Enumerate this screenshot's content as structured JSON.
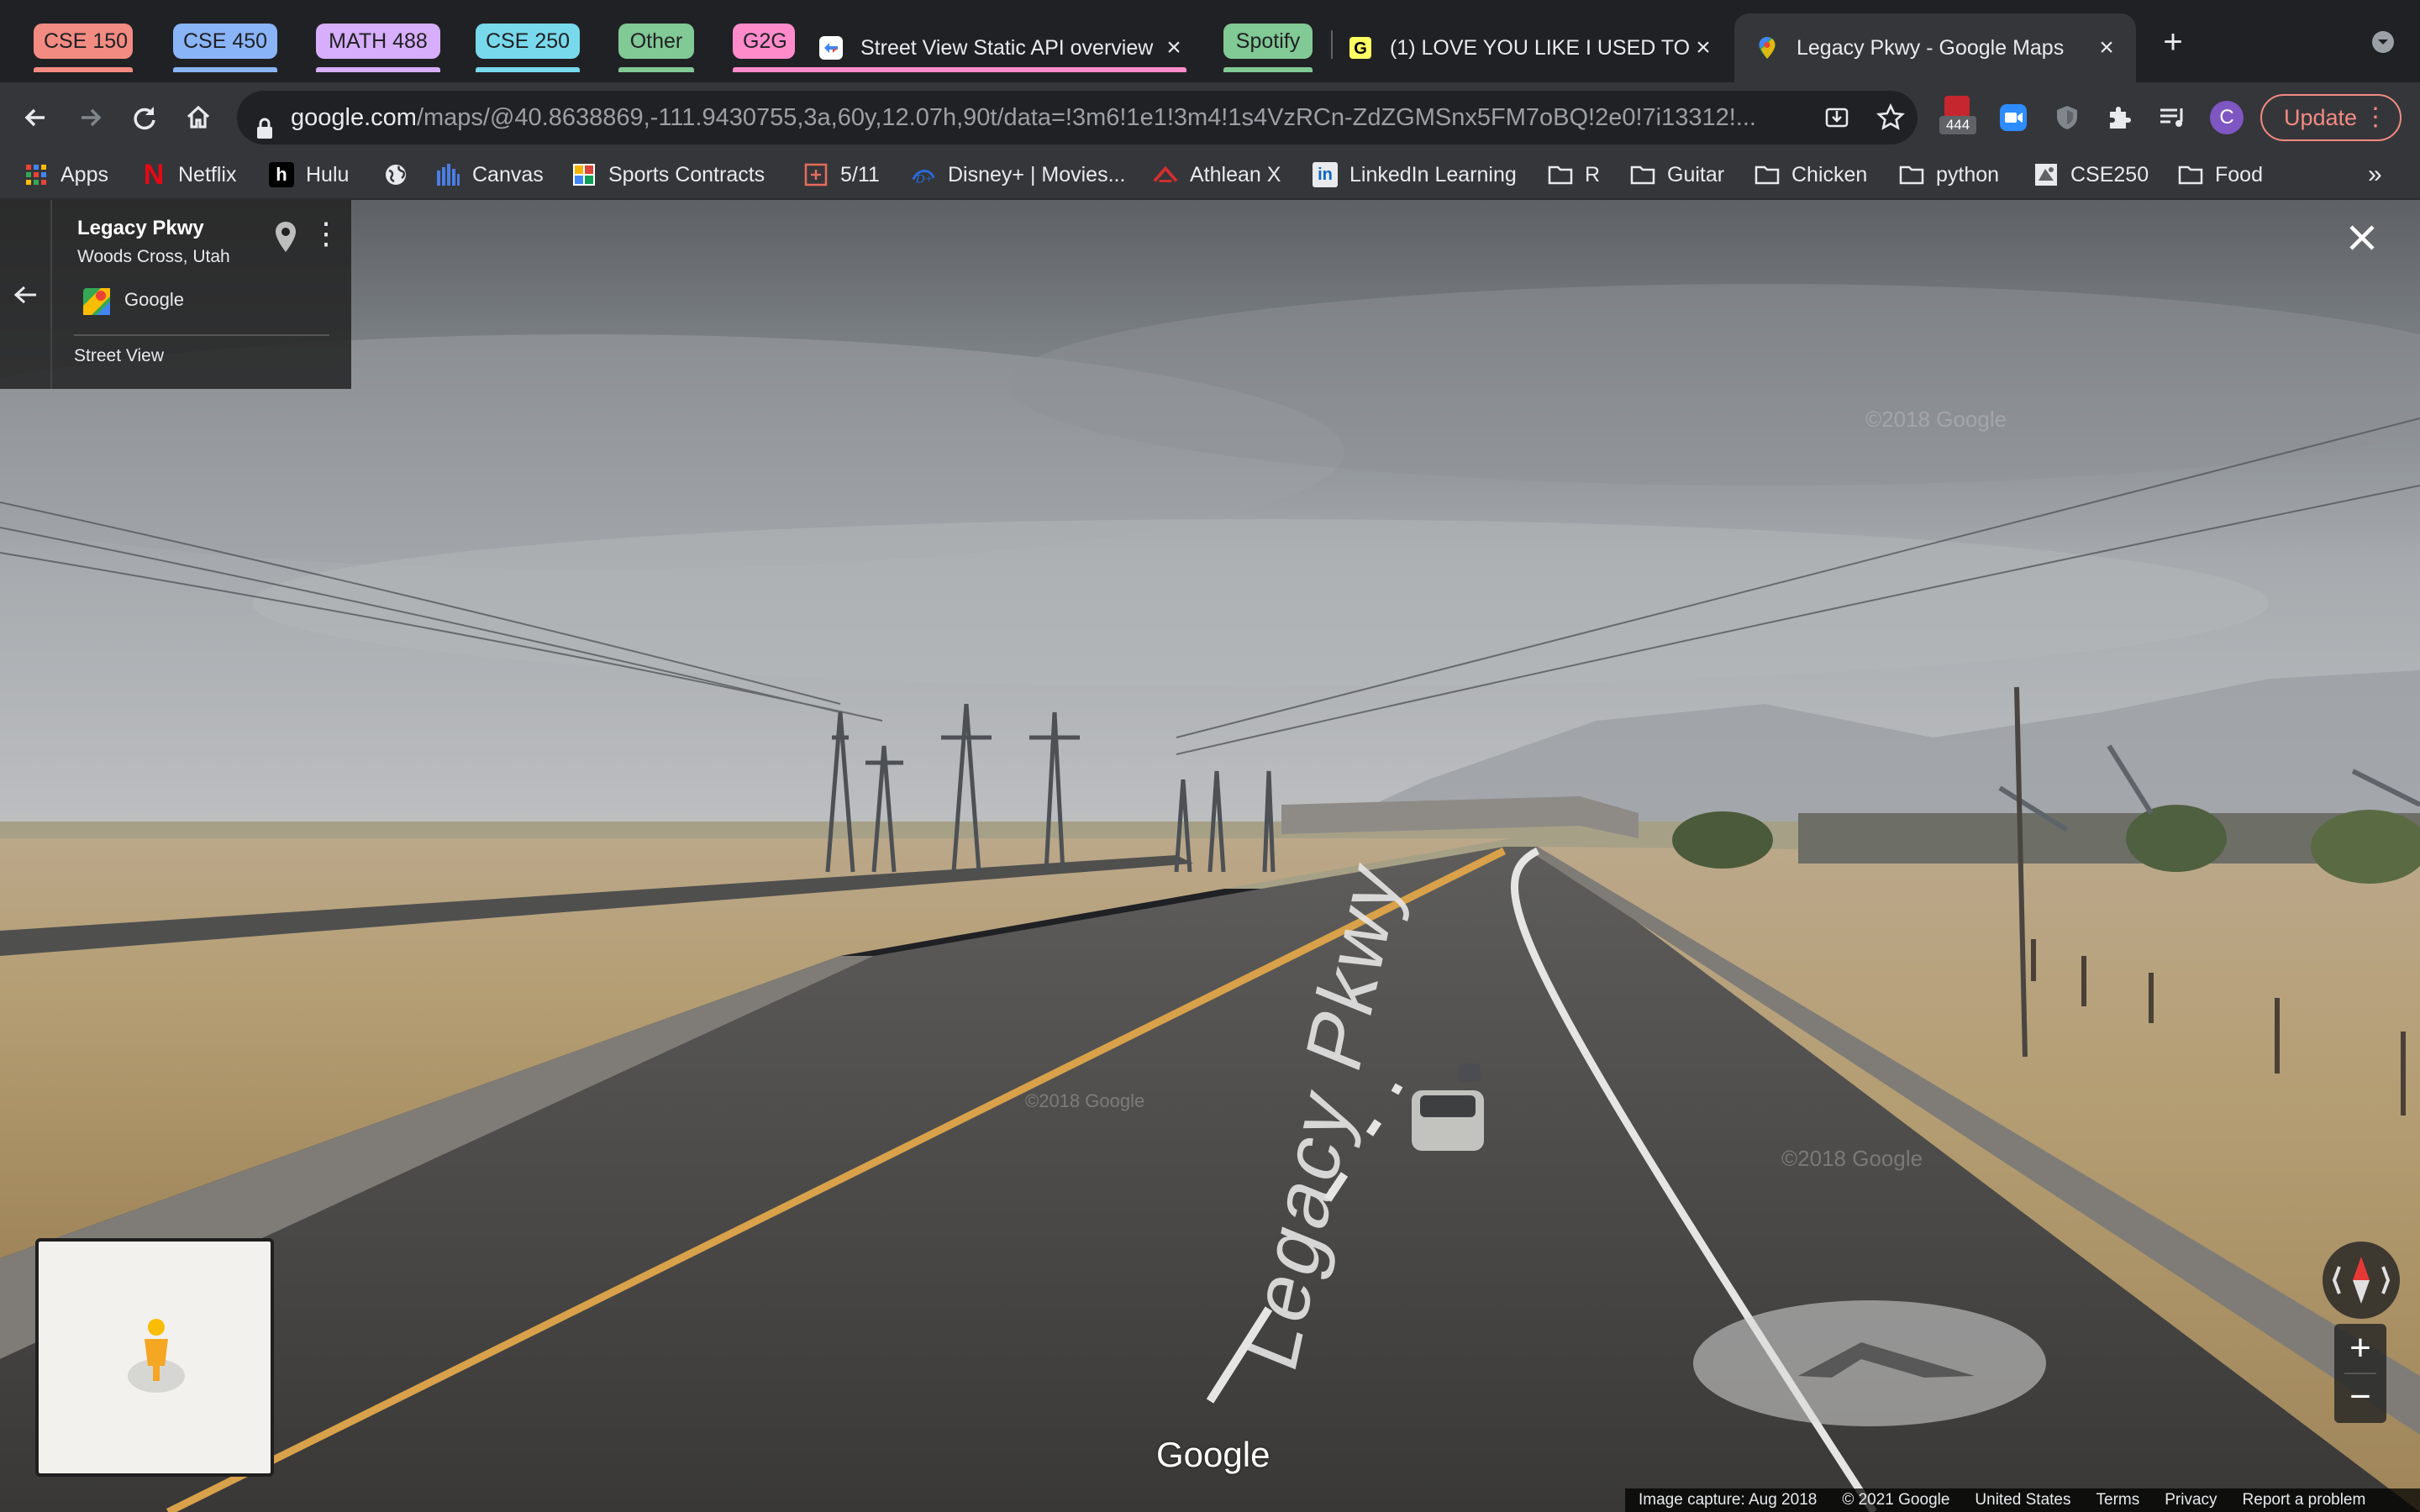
{
  "tab_groups": [
    {
      "label": "CSE 150",
      "color": "#f28b82"
    },
    {
      "label": "CSE 450",
      "color": "#8ab4f8"
    },
    {
      "label": "MATH 488",
      "color": "#d7aefb"
    },
    {
      "label": "CSE 250",
      "color": "#78d9ec"
    },
    {
      "label": "Other",
      "color": "#81c995"
    },
    {
      "label": "G2G",
      "color": "#ff8bcb"
    },
    {
      "label": "Spotify",
      "color": "#81c995"
    }
  ],
  "tabs": [
    {
      "title": "Street View Static API overview",
      "favicon": "google-dev-icon"
    },
    {
      "title": "(1) LOVE YOU LIKE I USED TO | ",
      "favicon": "genius-icon"
    },
    {
      "title": "Legacy Pkwy - Google Maps",
      "favicon": "maps-pin-icon"
    }
  ],
  "toolbar": {
    "url_host": "google.com",
    "url_rest": "/maps/@40.8638869,-111.9430755,3a,60y,12.07h,90t/data=!3m6!1e1!3m4!1s4VzRCn-ZdZGMSnx5FM7oBQ!2e0!7i13312!...",
    "extension_badge": "444",
    "profile_initial": "C",
    "update_label": "Update"
  },
  "bookmarks": [
    {
      "label": "Apps",
      "icon": "apps-grid-icon"
    },
    {
      "label": "Netflix",
      "icon": "netflix-icon"
    },
    {
      "label": "Hulu",
      "icon": "hulu-icon"
    },
    {
      "label": "",
      "icon": "globe-icon"
    },
    {
      "label": "Canvas",
      "icon": "canvas-icon"
    },
    {
      "label": "Sports Contracts",
      "icon": "sports-icon"
    },
    {
      "label": "5/11",
      "icon": "calendar-icon"
    },
    {
      "label": "Disney+ | Movies...",
      "icon": "disney-icon"
    },
    {
      "label": "Athlean X",
      "icon": "athlean-icon"
    },
    {
      "label": "LinkedIn Learning",
      "icon": "linkedin-icon"
    },
    {
      "label": "R",
      "icon": "folder-icon"
    },
    {
      "label": "Guitar",
      "icon": "folder-icon"
    },
    {
      "label": "Chicken",
      "icon": "folder-icon"
    },
    {
      "label": "python",
      "icon": "folder-icon"
    },
    {
      "label": "CSE250",
      "icon": "cse-icon"
    },
    {
      "label": "Food",
      "icon": "folder-icon"
    }
  ],
  "streetview": {
    "place_title": "Legacy Pkwy",
    "place_subtitle": "Woods Cross, Utah",
    "attribution": "Google",
    "mode_label": "Street View",
    "road_label": "Legacy Pkwy",
    "watermark": "©2018 Google",
    "logo": "Google",
    "footer": {
      "capture": "Image capture: Aug 2018",
      "copyright": "© 2021 Google",
      "country": "United States",
      "terms": "Terms",
      "privacy": "Privacy",
      "report": "Report a problem"
    }
  }
}
